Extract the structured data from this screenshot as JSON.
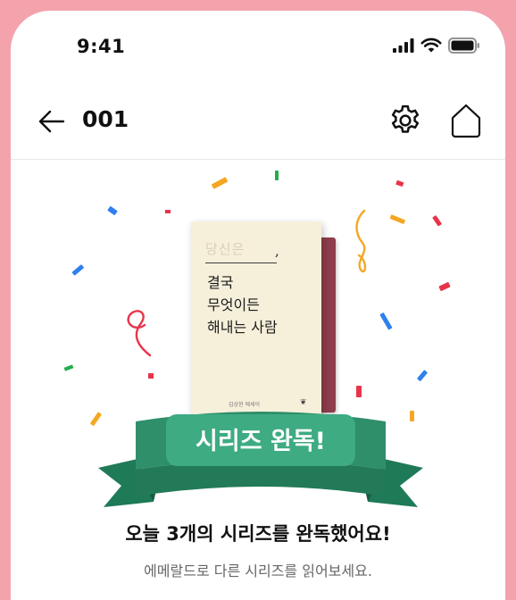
{
  "status_bar": {
    "time": "9:41",
    "icons": [
      "cellular-signal-icon",
      "wifi-icon",
      "battery-icon"
    ]
  },
  "header": {
    "title": "001",
    "icons": [
      "back-arrow-icon",
      "gear-icon",
      "home-icon"
    ]
  },
  "book": {
    "subtitle": "당신은",
    "comma": ",",
    "title_lines": [
      "결국",
      "무엇이든",
      "해내는 사람"
    ],
    "author": "김상현 에세이",
    "cover_color": "#f6f0db",
    "spine_color": "#8d3d4c"
  },
  "ribbon": {
    "label": "시리즈 완독!",
    "color": "#2e8f6a"
  },
  "message": {
    "heading": "오늘 3개의 시리즈를 완독했어요!",
    "subtext": "에메랄드로 다른 시리즈를 읽어보세요."
  },
  "colors": {
    "frame": "#f4a3ad",
    "background": "#ffffff",
    "confetti": [
      "#f5a623",
      "#e8344a",
      "#2f80ed",
      "#1fae4b"
    ]
  }
}
